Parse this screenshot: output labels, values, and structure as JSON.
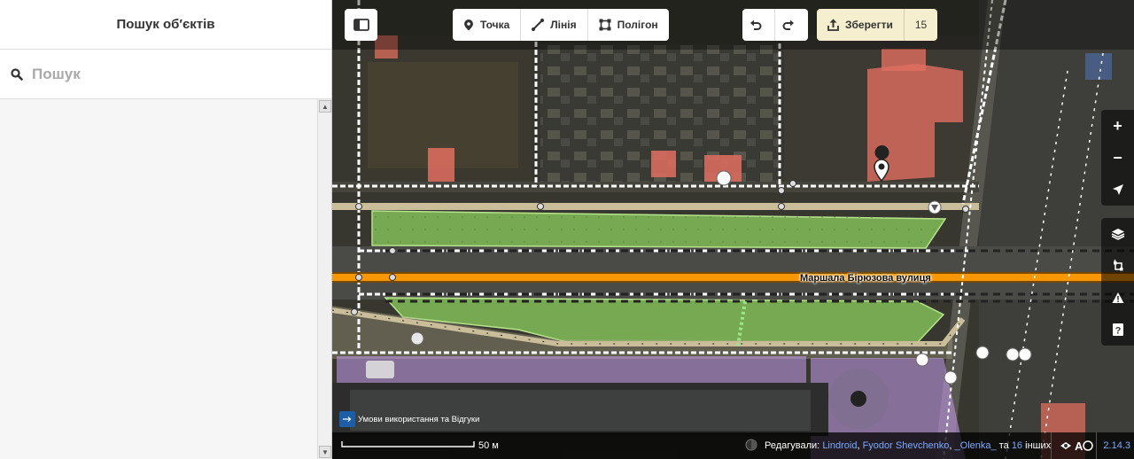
{
  "sidebar": {
    "title": "Пошук об′єктів",
    "search_placeholder": "Пошук"
  },
  "toolbar": {
    "point_label": "Точка",
    "line_label": "Лінія",
    "polygon_label": "Полігон",
    "save_label": "Зберегти",
    "edit_count": "15"
  },
  "map": {
    "street_label": "Маршала Бірюзова вулиця",
    "scale_label": "50 м",
    "terms_label": "Умови використання та Відгуки",
    "credits": {
      "prefix": "Редагували:",
      "users": [
        "Lindroid",
        "Fyodor Shevchenko",
        "_Olenka_"
      ],
      "and_text": "та",
      "others_count": "16",
      "others_text": "інших"
    },
    "version": "2.14.3"
  },
  "colors": {
    "road_primary": "#f99806",
    "green_area": "#8cd05f",
    "building": "#e06e5f",
    "purple_area": "#c99ff0",
    "link": "#7aaaff"
  }
}
